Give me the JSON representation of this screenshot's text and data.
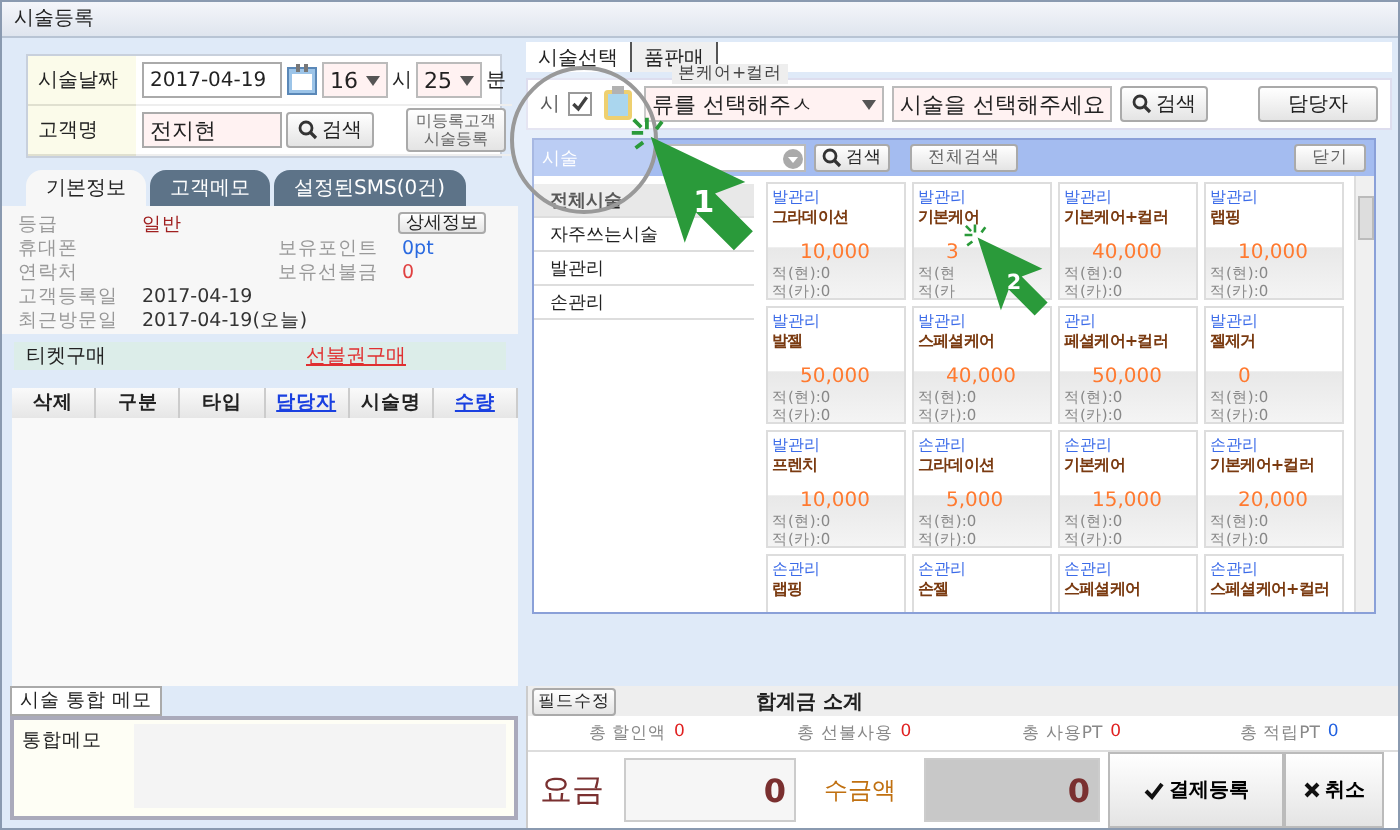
{
  "window": {
    "title": "시술등록"
  },
  "form": {
    "date_label": "시술날짜",
    "date": "2017-04-19",
    "hour": "16",
    "hour_unit": "시",
    "minute": "25",
    "minute_unit": "분",
    "name_label": "고객명",
    "name": "전지현",
    "search_button": "검색",
    "unregistered_button": "미등록고객 시술등록"
  },
  "customer_tabs": [
    {
      "label": "기본정보",
      "selected": true
    },
    {
      "label": "고객메모",
      "selected": false
    },
    {
      "label": "설정된SMS(0건)",
      "selected": false
    }
  ],
  "info": {
    "detail_button": "상세정보",
    "left": [
      {
        "label": "등급",
        "value": "일반",
        "color": "#a02020"
      },
      {
        "label": "휴대폰"
      },
      {
        "label": "연락처"
      },
      {
        "label": "고객등록일",
        "value": "2017-04-19",
        "color": "#333333"
      },
      {
        "label": "최근방문일",
        "value": "2017-04-19(오늘)",
        "color": "#333333"
      }
    ],
    "right": [
      {
        "label": "보유포인트",
        "value": "0pt",
        "color": "#2a6ae0"
      },
      {
        "label": "보유선불금",
        "value": "0",
        "color": "#e04040"
      }
    ]
  },
  "ticket": {
    "label": "티켓구매",
    "link": "선불권구매"
  },
  "table": {
    "columns": [
      {
        "label": "삭제",
        "link": false
      },
      {
        "label": "구분",
        "link": false
      },
      {
        "label": "타입",
        "link": false
      },
      {
        "label": "담당자",
        "link": true
      },
      {
        "label": "시술명",
        "link": false
      },
      {
        "label": "수량",
        "link": true
      }
    ]
  },
  "service_tabs": [
    {
      "label": "시술선택",
      "selected": true
    },
    {
      "label": "품판매",
      "selected": false
    }
  ],
  "toolbar": {
    "label": "시",
    "checked": true,
    "category_select": "류를 선택해주ㅅ",
    "service_select": "시술을 선택해주세요",
    "search_button": "검색",
    "staff_button": "담당자",
    "tooltip": "본케어+컬러"
  },
  "popup": {
    "title": "시술",
    "search_button": "검색",
    "all_button": "전체검색",
    "close_button": "닫기",
    "categories": [
      {
        "label": "전체시술",
        "selected": true
      },
      {
        "label": "자주쓰는시술",
        "selected": false
      },
      {
        "label": "발관리",
        "selected": false
      },
      {
        "label": "손관리",
        "selected": false
      }
    ],
    "cards": [
      {
        "category": "발관리",
        "name": "그라데이션",
        "price": "10,000",
        "points": [
          "적(현):0",
          "적(카):0"
        ]
      },
      {
        "category": "발관리",
        "name": "기본케어",
        "price": "3",
        "points": [
          "적(현",
          "적(카"
        ]
      },
      {
        "category": "발관리",
        "name": "기본케어+컬러",
        "price": "40,000",
        "points": [
          "적(현):0",
          "적(카):0"
        ]
      },
      {
        "category": "발관리",
        "name": "랩핑",
        "price": "10,000",
        "points": [
          "적(현):0",
          "적(카):0"
        ]
      },
      {
        "category": "발관리",
        "name": "발젤",
        "price": "50,000",
        "points": [
          "적(현):0",
          "적(카):0"
        ]
      },
      {
        "category": "발관리",
        "name": "스페셜케어",
        "price": "40,000",
        "points": [
          "적(현):0",
          "적(카):0"
        ]
      },
      {
        "category": "관리",
        "name": "페셜케어+컬러",
        "price": "50,000",
        "points": [
          "적(현):0",
          "적(카):0"
        ]
      },
      {
        "category": "발관리",
        "name": "젤제거",
        "price": "0",
        "points": [
          "적(현):0",
          "적(카):0"
        ]
      },
      {
        "category": "발관리",
        "name": "프렌치",
        "price": "10,000",
        "points": [
          "적(현):0",
          "적(카):0"
        ]
      },
      {
        "category": "손관리",
        "name": "그라데이션",
        "price": "5,000",
        "points": [
          "적(현):0",
          "적(카):0"
        ]
      },
      {
        "category": "손관리",
        "name": "기본케어",
        "price": "15,000",
        "points": [
          "적(현):0",
          "적(카):0"
        ]
      },
      {
        "category": "손관리",
        "name": "기본케어+컬러",
        "price": "20,000",
        "points": [
          "적(현):0",
          "적(카):0"
        ]
      },
      {
        "category": "손관리",
        "name": "랩핑"
      },
      {
        "category": "손관리",
        "name": "손젤"
      },
      {
        "category": "손관리",
        "name": "스페셜케어"
      },
      {
        "category": "손관리",
        "name": "스페셜케어+컬러"
      }
    ]
  },
  "memo": {
    "tab": "시술 통합 메모",
    "label": "통합메모"
  },
  "totals": {
    "edit_button": "필드수정",
    "title": "합계금 소계",
    "stats": [
      {
        "label": "총 할인액",
        "value": "0",
        "color": "#e02020"
      },
      {
        "label": "총 선불사용",
        "value": "0",
        "color": "#e02020"
      },
      {
        "label": "총 사용PT",
        "value": "0",
        "color": "#e02020"
      },
      {
        "label": "총 적립PT",
        "value": "0",
        "color": "#2060e0"
      }
    ],
    "fee_label": "요금",
    "fee": "0",
    "received_label": "수금액",
    "received": "0",
    "pay_button": "결제등록",
    "cancel_button": "취소"
  },
  "annotations": [
    {
      "label": "1"
    },
    {
      "label": "2"
    }
  ]
}
